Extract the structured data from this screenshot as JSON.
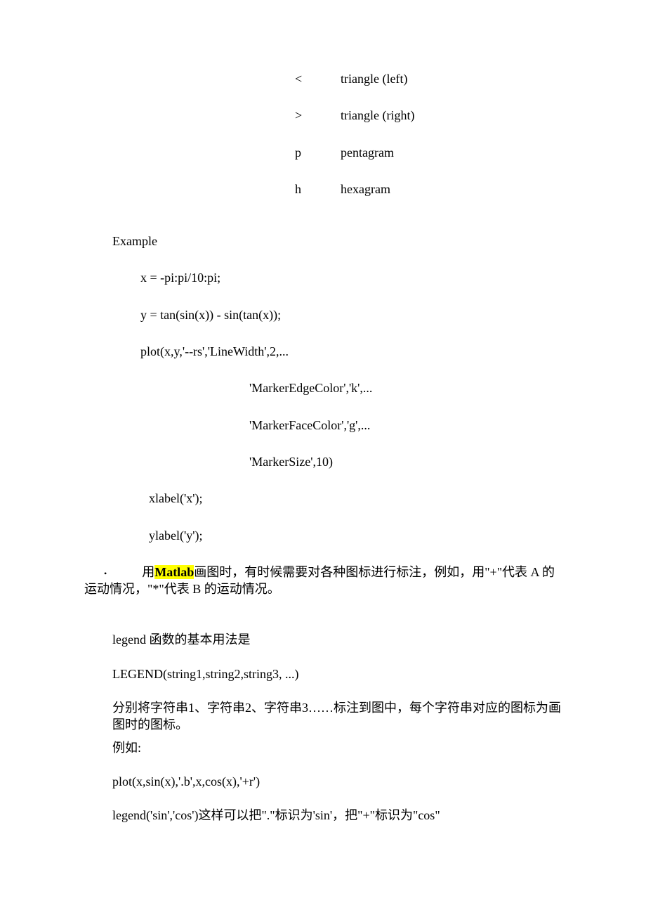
{
  "symbols": [
    {
      "k": "<",
      "v": "triangle (left)"
    },
    {
      "k": ">",
      "v": "triangle (right)"
    },
    {
      "k": "p",
      "v": "pentagram"
    },
    {
      "k": "h",
      "v": "hexagram"
    }
  ],
  "example_label": "Example",
  "code": {
    "l1": "x = -pi:pi/10:pi;",
    "l2": "y = tan(sin(x)) - sin(tan(x));",
    "l3": "plot(x,y,'--rs','LineWidth',2,...",
    "l4": "'MarkerEdgeColor','k',...",
    "l5": "'MarkerFaceColor','g',...",
    "l6": "'MarkerSize',10)",
    "l7": "xlabel('x');",
    "l8": "ylabel('y');"
  },
  "bullet1": {
    "prefix": "用",
    "highlight": "Matlab",
    "rest": "画图时，有时候需要对各种图标进行标注，例如，用\"+\"代表 A 的运动情况，\"*\"代表 B 的运动情况。"
  },
  "legend": {
    "p1": "legend 函数的基本用法是",
    "p2": "LEGEND(string1,string2,string3, ...)",
    "p3": "分别将字符串1、字符串2、字符串3……标注到图中，每个字符串对应的图标为画图时的图标。",
    "p4": "例如:",
    "p5": "plot(x,sin(x),'.b',x,cos(x),'+r')",
    "p6": "legend('sin','cos')这样可以把\".\"标识为'sin'，把\"+\"标识为\"cos\""
  }
}
